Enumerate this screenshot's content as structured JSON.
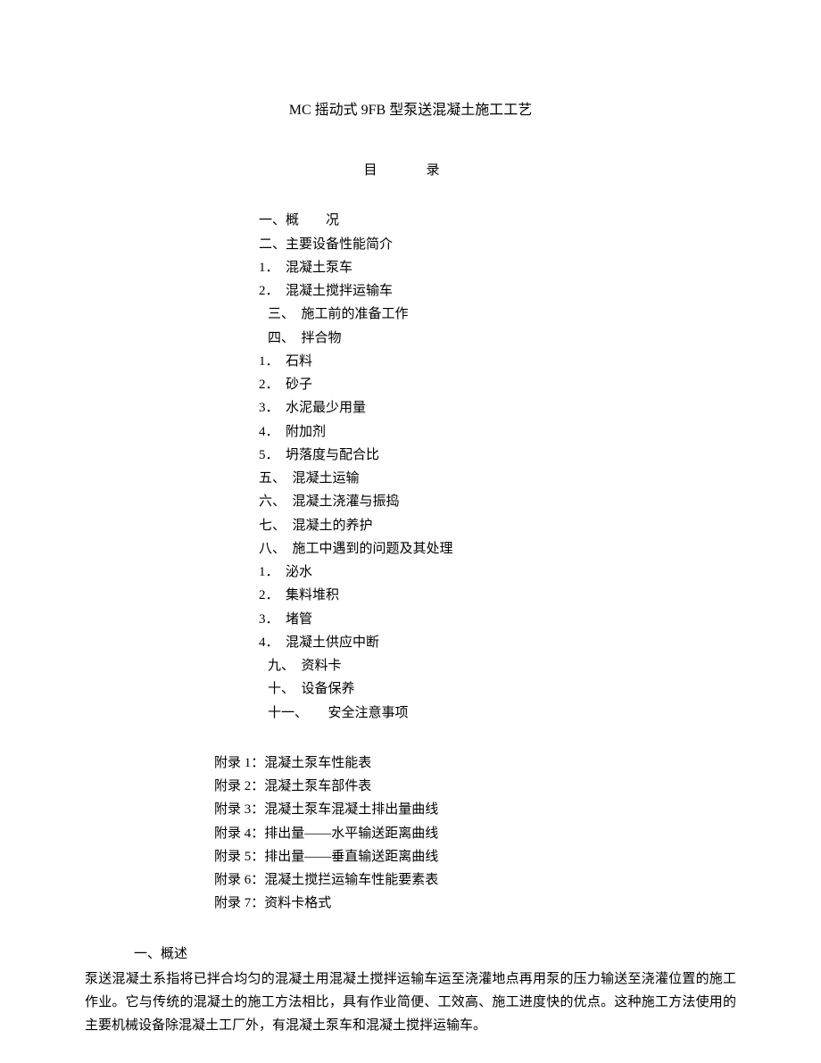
{
  "title": "MC 摇动式 9FB 型泵送混凝土施工工艺",
  "toc_heading": "目　录",
  "toc": {
    "items": [
      {
        "text": "一、概　　况",
        "indent": 0
      },
      {
        "text": "二、主要设备性能简介",
        "indent": 0
      },
      {
        "text": "1．　混凝土泵车",
        "indent": 0
      },
      {
        "text": "2．　混凝土搅拌运输车",
        "indent": 0
      },
      {
        "text": "三、　施工前的准备工作",
        "indent": 1
      },
      {
        "text": "四、　拌合物",
        "indent": 1
      },
      {
        "text": "1．　石料",
        "indent": 0
      },
      {
        "text": "2．　砂子",
        "indent": 0
      },
      {
        "text": "3．　水泥最少用量",
        "indent": 0
      },
      {
        "text": "4．　附加剂",
        "indent": 0
      },
      {
        "text": "5．　坍落度与配合比",
        "indent": 0
      },
      {
        "text": "五、　混凝土运输",
        "indent": 0
      },
      {
        "text": "六、　混凝土浇灌与振捣",
        "indent": 0
      },
      {
        "text": "七、　混凝土的养护",
        "indent": 0
      },
      {
        "text": "八、　施工中遇到的问题及其处理",
        "indent": 0
      },
      {
        "text": "1．　泌水",
        "indent": 0
      },
      {
        "text": "2．　集料堆积",
        "indent": 0
      },
      {
        "text": "3．　堵管",
        "indent": 0
      },
      {
        "text": "4．　混凝土供应中断",
        "indent": 0
      },
      {
        "text": "九、　资料卡",
        "indent": 1
      },
      {
        "text": "十、　设备保养",
        "indent": 1
      },
      {
        "text": "十一、　　安全注意事项",
        "indent": 1
      }
    ]
  },
  "appendix": {
    "items": [
      "附录 1：混凝土泵车性能表",
      "附录 2：混凝土泵车部件表",
      "附录 3：混凝土泵车混凝土排出量曲线",
      "附录 4：排出量——水平输送距离曲线",
      "附录 5：排出量——垂直输送距离曲线",
      "附录 6：混凝土搅拦运输车性能要素表",
      "附录 7：资料卡格式"
    ]
  },
  "section_heading": "一、概述",
  "body_paragraph": "泵送混凝土系指将已拌合均匀的混凝土用混凝土搅拌运输车运至浇灌地点再用泵的压力输送至浇灌位置的施工作业。它与传统的混凝土的施工方法相比，具有作业简便、工效高、施工进度快的优点。这种施工方法使用的主要机械设备除混凝土工厂外，有混凝土泵车和混凝土搅拌运输车。"
}
